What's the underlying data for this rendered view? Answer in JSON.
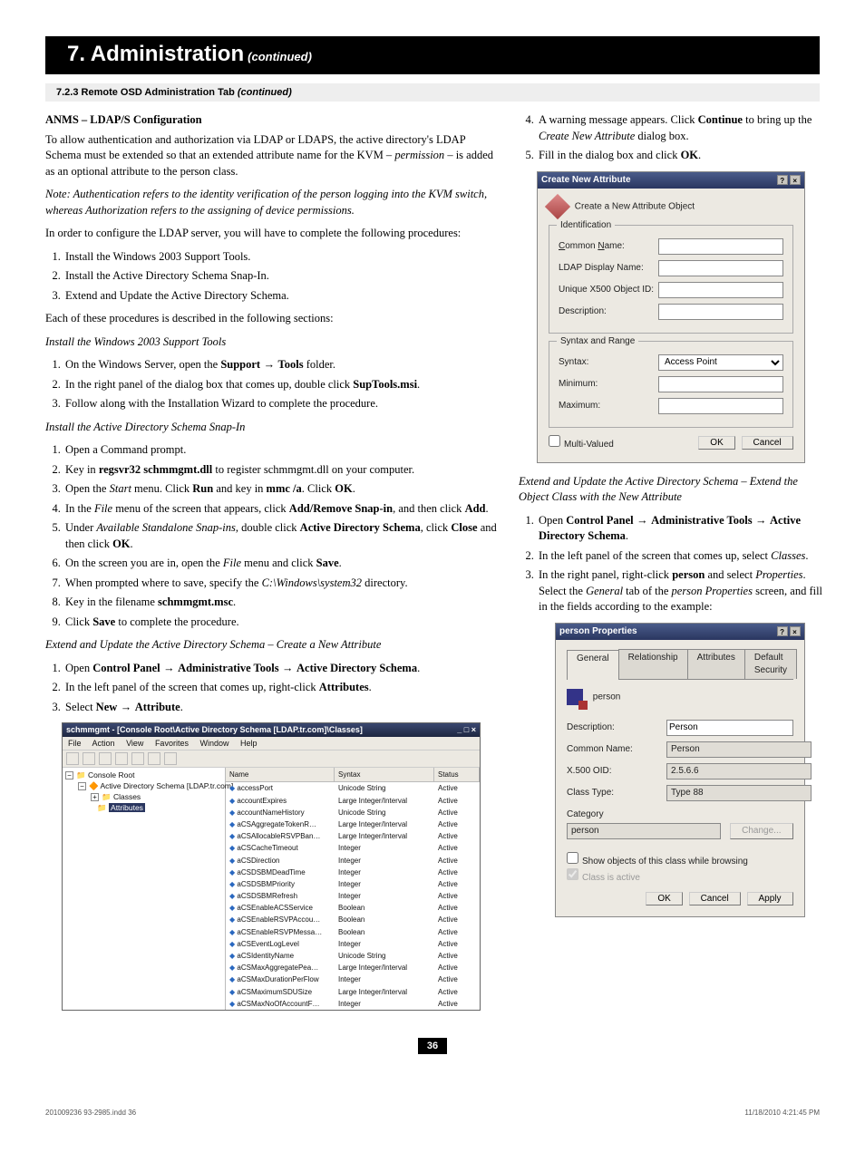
{
  "chapter": {
    "num_title": "7. Administration",
    "continued": "(continued)"
  },
  "subheader": {
    "number": "7.2.3",
    "text": "Remote OSD Administration Tab",
    "suffix": "(continued)"
  },
  "left": {
    "h3": "ANMS – LDAP/S Configuration",
    "p1_a": "To allow authentication and authorization via LDAP or LDAPS, the active directory's LDAP Schema must be extended so that an extended attribute name for the KVM – ",
    "p1_i": "permission",
    "p1_b": " – is added as an optional attribute to the person class.",
    "note": "Note: Authentication refers to the identity verification of the person logging into the KVM switch, whereas Authorization refers to the assigning of device permissions.",
    "p2": "In order to configure the LDAP server, you will have to complete the following procedures:",
    "proc_list": [
      "Install the Windows 2003 Support Tools.",
      "Install the Active Directory Schema Snap-In.",
      "Extend and Update the Active Directory Schema."
    ],
    "p3": "Each of these procedures is described in the following sections:",
    "h_inst_tools": "Install the Windows 2003 Support Tools",
    "inst_tools": [
      {
        "pre": "On the Windows Server, open the ",
        "b1": "Support",
        "arrow": " → ",
        "b2": "Tools",
        "post": " folder."
      },
      {
        "pre": "In the right panel of the dialog box that comes up, double click ",
        "b1": "SupTools.msi",
        "post": "."
      },
      {
        "pre": "Follow along with the Installation Wizard to complete the procedure."
      }
    ],
    "h_inst_snapin": "Install the Active Directory Schema Snap-In",
    "snapin_list": [
      {
        "text": "Open a Command prompt."
      },
      {
        "pre": "Key in ",
        "b": "regsvr32 schmmgmt.dll",
        "post": " to register schmmgmt.dll on your computer."
      },
      {
        "pre": "Open the ",
        "i": "Start",
        "mid": " menu. Click ",
        "b": "Run",
        "mid2": " and key in ",
        "b2": "mmc /a",
        "mid3": ". Click ",
        "b3": "OK",
        "post": "."
      },
      {
        "pre": "In the ",
        "i": "File",
        "mid": " menu of the screen that appears, click ",
        "b": "Add/Remove Snap-in",
        "mid2": ", and then click ",
        "b2": "Add",
        "post": "."
      },
      {
        "pre": "Under ",
        "i": "Available Standalone Snap-ins",
        "mid": ", double click ",
        "b": "Active Directory Schema",
        "mid2": ", click ",
        "b2": "Close",
        "mid3": " and then click ",
        "b3": "OK",
        "post": "."
      },
      {
        "pre": "On the screen you are in, open the ",
        "i": "File",
        "mid": " menu and click ",
        "b": "Save",
        "post": "."
      },
      {
        "pre": "When prompted where to save, specify the ",
        "i": "C:\\Windows\\system32",
        "post": " directory."
      },
      {
        "pre": "Key in the filename ",
        "b": "schmmgmt.msc",
        "post": "."
      },
      {
        "pre": "Click ",
        "b": "Save",
        "post": " to complete the procedure."
      }
    ],
    "h_extend": "Extend and Update the Active Directory Schema – Create a New Attribute",
    "extend_list": [
      {
        "pre": "Open ",
        "b": "Control Panel",
        "arrow": " → ",
        "b2": "Administrative Tools",
        "arrow2": " → ",
        "b3": "Active Directory Schema",
        "post": "."
      },
      {
        "pre": "In the left panel of the screen that comes up, right-click ",
        "b": "Attributes",
        "post": "."
      },
      {
        "pre": "Select ",
        "b": "New",
        "arrow": " → ",
        "b2": "Attribute",
        "post": "."
      }
    ]
  },
  "right": {
    "intro_list": [
      {
        "pre": "A warning message appears. Click ",
        "b": "Continue",
        "mid": " to bring up the ",
        "i": "Create New Attribute",
        "post": " dialog box."
      },
      {
        "pre": "Fill in the dialog box and click ",
        "b": "OK",
        "post": "."
      }
    ],
    "h_extend2": "Extend and Update the Active Directory Schema – Extend the Object Class with the New Attribute",
    "extend2_list": [
      {
        "pre": "Open ",
        "b": "Control Panel",
        "arrow": " → ",
        "b2": "Administrative Tools",
        "arrow2": " → ",
        "b3": "Active Directory Schema",
        "post": "."
      },
      {
        "pre": "In the left panel of the screen that comes up, select ",
        "i": "Classes",
        "post": "."
      },
      {
        "pre": "In the right panel, right-click ",
        "b": "person",
        "mid": " and select ",
        "i": "Properties",
        "mid2": ". Select the ",
        "i2": "General",
        "mid3": " tab of the ",
        "i3": "person Properties",
        "post": " screen, and fill in the fields according to the example:"
      }
    ]
  },
  "dialog1": {
    "title": "Create New Attribute",
    "heading": "Create a New Attribute Object",
    "grp_ident": "Identification",
    "common_name": "Common Name:",
    "ldap_display": "LDAP Display Name:",
    "unique_oid": "Unique X500 Object ID:",
    "description": "Description:",
    "grp_syntax": "Syntax and Range",
    "syntax": "Syntax:",
    "syntax_val": "Access Point",
    "minimum": "Minimum:",
    "maximum": "Maximum:",
    "multi": "Multi-Valued",
    "ok": "OK",
    "cancel": "Cancel"
  },
  "dialog2": {
    "title": "person Properties",
    "tabs": [
      "General",
      "Relationship",
      "Attributes",
      "Default Security"
    ],
    "iconlabel": "person",
    "description_l": "Description:",
    "description_v": "Person",
    "common_l": "Common Name:",
    "common_v": "Person",
    "oid_l": "X.500 OID:",
    "oid_v": "2.5.6.6",
    "classtype_l": "Class Type:",
    "classtype_v": "Type 88",
    "category_l": "Category",
    "category_v": "person",
    "change": "Change...",
    "show_checkbox": "Show objects of this class while browsing",
    "inactive_checkbox": "Class is active",
    "ok": "OK",
    "cancel": "Cancel",
    "apply": "Apply"
  },
  "mmc": {
    "title": "schmmgmt - [Console Root\\Active Directory Schema [LDAP.tr.com]\\Classes]",
    "menus": [
      "File",
      "Action",
      "View",
      "Favorites",
      "Window",
      "Help"
    ],
    "tree_root": "Console Root",
    "tree_ad": "Active Directory Schema [LDAP.tr.com]",
    "tree_classes": "Classes",
    "tree_attributes": "Attributes",
    "cols": {
      "name": "Name",
      "syntax": "Syntax",
      "status": "Status"
    },
    "rows": [
      {
        "n": "accessPort",
        "s": "Unicode String",
        "t": "Active"
      },
      {
        "n": "accountExpires",
        "s": "Large Integer/Interval",
        "t": "Active"
      },
      {
        "n": "accountNameHistory",
        "s": "Unicode String",
        "t": "Active"
      },
      {
        "n": "aCSAggregateTokenR…",
        "s": "Large Integer/Interval",
        "t": "Active"
      },
      {
        "n": "aCSAllocableRSVPBan…",
        "s": "Large Integer/Interval",
        "t": "Active"
      },
      {
        "n": "aCSCacheTimeout",
        "s": "Integer",
        "t": "Active"
      },
      {
        "n": "aCSDirection",
        "s": "Integer",
        "t": "Active"
      },
      {
        "n": "aCSDSBMDeadTime",
        "s": "Integer",
        "t": "Active"
      },
      {
        "n": "aCSDSBMPriority",
        "s": "Integer",
        "t": "Active"
      },
      {
        "n": "aCSDSBMRefresh",
        "s": "Integer",
        "t": "Active"
      },
      {
        "n": "aCSEnableACSService",
        "s": "Boolean",
        "t": "Active"
      },
      {
        "n": "aCSEnableRSVPAccou…",
        "s": "Boolean",
        "t": "Active"
      },
      {
        "n": "aCSEnableRSVPMessa…",
        "s": "Boolean",
        "t": "Active"
      },
      {
        "n": "aCSEventLogLevel",
        "s": "Integer",
        "t": "Active"
      },
      {
        "n": "aCSIdentityName",
        "s": "Unicode String",
        "t": "Active"
      },
      {
        "n": "aCSMaxAggregatePea…",
        "s": "Large Integer/Interval",
        "t": "Active"
      },
      {
        "n": "aCSMaxDurationPerFlow",
        "s": "Integer",
        "t": "Active"
      },
      {
        "n": "aCSMaximumSDUSize",
        "s": "Large Integer/Interval",
        "t": "Active"
      },
      {
        "n": "aCSMaxNoOfAccountF…",
        "s": "Integer",
        "t": "Active"
      }
    ]
  },
  "page_number": "36",
  "footer_left": "201009236 93-2985.indd   36",
  "footer_right": "11/18/2010   4:21:45 PM"
}
